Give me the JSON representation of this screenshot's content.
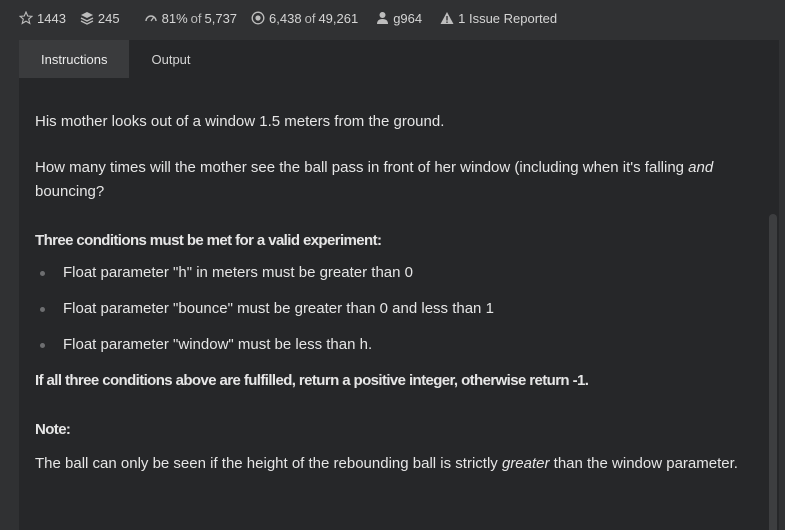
{
  "stats": {
    "stars": "1443",
    "kata": "245",
    "satisfaction": "81%",
    "satisfaction_of": "of",
    "satisfaction_votes": "5,737",
    "completions": "6,438",
    "completions_of": "of",
    "completions_total": "49,261",
    "author": "g964",
    "issues": "1 Issue Reported",
    "icons": [
      "star-icon",
      "stack-icon",
      "gauge-icon",
      "target-icon",
      "user-icon",
      "warning-icon"
    ]
  },
  "tabs": {
    "instructions": "Instructions",
    "output": "Output"
  },
  "content": {
    "p1": "His mother looks out of a window 1.5 meters from the ground.",
    "p2_before": "How many times will the mother see the ball pass in front of her window (including when it's falling ",
    "p2_em": "and",
    "p2_after": " bouncing?",
    "conditions_heading": "Three conditions must be met for a valid experiment:",
    "conditions": [
      "Float parameter \"h\" in meters must be greater than 0",
      "Float parameter \"bounce\" must be greater than 0 and less than 1",
      "Float parameter \"window\" must be less than h."
    ],
    "result_heading": "If all three conditions above are fulfilled, return a positive integer, otherwise return -1.",
    "note_heading": "Note:",
    "note_before": "The ball can only be seen if the height of the rebounding ball is strictly ",
    "note_em": "greater",
    "note_after": " than the window parameter."
  },
  "colors": {
    "background": "#303133",
    "panel": "#262729",
    "active_tab": "#3a3b3d",
    "text": "#e6e6e6"
  }
}
